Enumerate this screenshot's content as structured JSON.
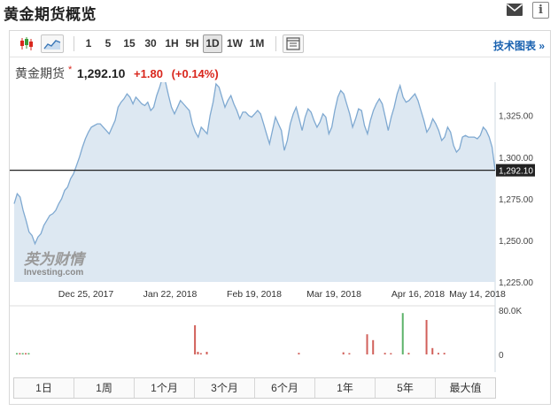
{
  "header": {
    "title": "黄金期货概览",
    "mail_icon": "mail-icon",
    "info_icon": "info-icon",
    "info_glyph": "i"
  },
  "toolbar": {
    "chart_type_icons": [
      "candlestick-icon",
      "area-chart-icon"
    ],
    "intervals": [
      "1",
      "5",
      "15",
      "30",
      "1H",
      "5H",
      "1D",
      "1W",
      "1M"
    ],
    "active_interval": "1D",
    "settings_icon": "chart-settings-icon",
    "tech_chart_label": "技术图表",
    "tech_chart_arrow": "»"
  },
  "quote": {
    "name": "黄金期货",
    "star": "*",
    "price": "1,292.10",
    "change": "+1.80",
    "change_pct": "(+0.14%)",
    "color_up": "#d9271d"
  },
  "watermark": {
    "cn": "英为财情",
    "en": "Investing.com"
  },
  "chart_data": {
    "type": "area",
    "x_ticks": [
      "Dec 25, 2017",
      "Jan 22, 2018",
      "Feb 19, 2018",
      "Mar 19, 2018",
      "Apr 16, 2018",
      "May 14, 2018"
    ],
    "y_ticks": [
      "1,325.00",
      "1,300.00",
      "1,275.00",
      "1,250.00",
      "1,225.00"
    ],
    "ylim": [
      1225,
      1345
    ],
    "current_value": 1292.1,
    "current_label": "1,292.10",
    "values": [
      1272,
      1278,
      1276,
      1268,
      1262,
      1255,
      1253,
      1248,
      1252,
      1254,
      1259,
      1262,
      1265,
      1266,
      1268,
      1272,
      1275,
      1280,
      1282,
      1287,
      1290,
      1295,
      1300,
      1306,
      1311,
      1315,
      1318,
      1319,
      1320,
      1320,
      1318,
      1316,
      1314,
      1318,
      1322,
      1330,
      1333,
      1335,
      1338,
      1336,
      1332,
      1336,
      1334,
      1332,
      1331,
      1333,
      1328,
      1330,
      1337,
      1342,
      1348,
      1345,
      1337,
      1330,
      1326,
      1330,
      1334,
      1332,
      1330,
      1328,
      1320,
      1315,
      1312,
      1318,
      1316,
      1314,
      1325,
      1333,
      1344,
      1342,
      1336,
      1330,
      1334,
      1337,
      1332,
      1328,
      1323,
      1327,
      1327,
      1325,
      1324,
      1326,
      1328,
      1326,
      1320,
      1314,
      1308,
      1316,
      1324,
      1320,
      1316,
      1304,
      1310,
      1320,
      1326,
      1330,
      1323,
      1316,
      1324,
      1329,
      1327,
      1322,
      1318,
      1321,
      1326,
      1324,
      1314,
      1318,
      1328,
      1336,
      1340,
      1338,
      1332,
      1326,
      1318,
      1323,
      1329,
      1328,
      1319,
      1314,
      1322,
      1328,
      1332,
      1335,
      1332,
      1324,
      1316,
      1324,
      1330,
      1338,
      1343,
      1336,
      1333,
      1334,
      1336,
      1338,
      1334,
      1328,
      1322,
      1315,
      1318,
      1323,
      1320,
      1316,
      1310,
      1312,
      1318,
      1315,
      1307,
      1303,
      1305,
      1312,
      1313,
      1312,
      1312,
      1312,
      1311,
      1313,
      1318,
      1316,
      1312,
      1306,
      1292.1
    ],
    "volume_ticks": [
      "80.0K",
      "0"
    ],
    "volume_max": 80000,
    "volume_bars": [
      {
        "i": 0,
        "v": 2500,
        "c": "green"
      },
      {
        "i": 1,
        "v": 2000,
        "c": "red"
      },
      {
        "i": 2,
        "v": 2000,
        "c": "green"
      },
      {
        "i": 3,
        "v": 2000,
        "c": "red"
      },
      {
        "i": 4,
        "v": 1500,
        "c": "green"
      },
      {
        "i": 60,
        "v": 55000,
        "c": "red"
      },
      {
        "i": 61,
        "v": 5000,
        "c": "red"
      },
      {
        "i": 62,
        "v": 2500,
        "c": "red"
      },
      {
        "i": 64,
        "v": 5000,
        "c": "red"
      },
      {
        "i": 95,
        "v": 3000,
        "c": "red"
      },
      {
        "i": 110,
        "v": 4000,
        "c": "red"
      },
      {
        "i": 112,
        "v": 2000,
        "c": "red"
      },
      {
        "i": 118,
        "v": 38000,
        "c": "red"
      },
      {
        "i": 120,
        "v": 27000,
        "c": "red"
      },
      {
        "i": 124,
        "v": 3000,
        "c": "red"
      },
      {
        "i": 126,
        "v": 2000,
        "c": "red"
      },
      {
        "i": 130,
        "v": 78000,
        "c": "green"
      },
      {
        "i": 132,
        "v": 3000,
        "c": "red"
      },
      {
        "i": 138,
        "v": 65000,
        "c": "red"
      },
      {
        "i": 140,
        "v": 12000,
        "c": "red"
      },
      {
        "i": 142,
        "v": 3000,
        "c": "red"
      },
      {
        "i": 144,
        "v": 3000,
        "c": "red"
      }
    ]
  },
  "ranges": [
    "1日",
    "1周",
    "1个月",
    "3个月",
    "6个月",
    "1年",
    "5年",
    "最大值"
  ]
}
